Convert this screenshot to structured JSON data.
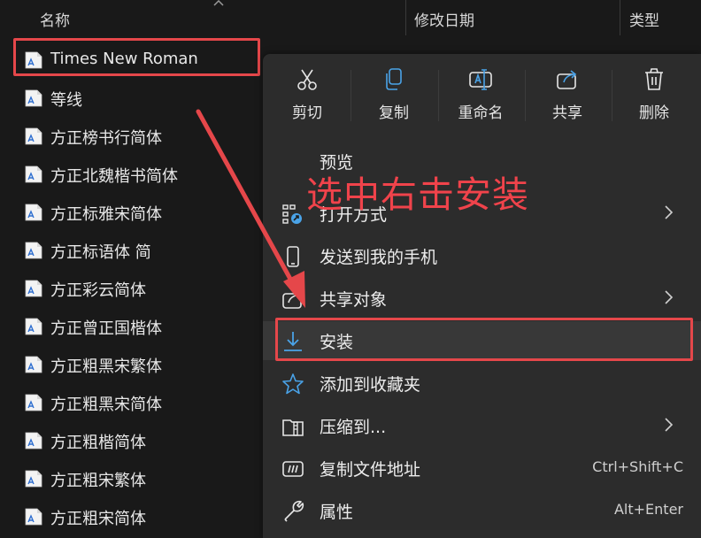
{
  "header": {
    "col_name": "名称",
    "col_date": "修改日期",
    "col_type": "类型"
  },
  "files": [
    {
      "name": "Times New Roman",
      "icon": "font-file-icon"
    },
    {
      "name": "等线",
      "icon": "font-file-icon"
    },
    {
      "name": "方正榜书行简体",
      "icon": "font-file-icon"
    },
    {
      "name": "方正北魏楷书简体",
      "icon": "font-file-icon"
    },
    {
      "name": "方正标雅宋简体",
      "icon": "font-file-icon"
    },
    {
      "name": "方正标语体 简",
      "icon": "font-file-icon"
    },
    {
      "name": "方正彩云简体",
      "icon": "font-file-icon"
    },
    {
      "name": "方正曾正国楷体",
      "icon": "font-file-icon"
    },
    {
      "name": "方正粗黑宋繁体",
      "icon": "font-file-icon"
    },
    {
      "name": "方正粗黑宋简体",
      "icon": "font-file-icon"
    },
    {
      "name": "方正粗楷简体",
      "icon": "font-file-icon"
    },
    {
      "name": "方正粗宋繁体",
      "icon": "font-file-icon"
    },
    {
      "name": "方正粗宋简体",
      "icon": "font-file-icon"
    }
  ],
  "context_menu": {
    "quick_actions": [
      {
        "label": "剪切",
        "icon": "cut-icon"
      },
      {
        "label": "复制",
        "icon": "copy-icon"
      },
      {
        "label": "重命名",
        "icon": "rename-icon"
      },
      {
        "label": "共享",
        "icon": "share-icon"
      },
      {
        "label": "删除",
        "icon": "delete-icon"
      }
    ],
    "items": [
      {
        "label": "预览",
        "icon": "",
        "submenu": false,
        "shortcut": ""
      },
      {
        "label": "打开方式",
        "icon": "open-with-icon",
        "submenu": true,
        "shortcut": ""
      },
      {
        "label": "发送到我的手机",
        "icon": "phone-icon",
        "submenu": false,
        "shortcut": ""
      },
      {
        "label": "共享对象",
        "icon": "share-with-icon",
        "submenu": true,
        "shortcut": ""
      },
      {
        "label": "安装",
        "icon": "install-icon",
        "submenu": false,
        "shortcut": ""
      },
      {
        "label": "添加到收藏夹",
        "icon": "star-icon",
        "submenu": false,
        "shortcut": ""
      },
      {
        "label": "压缩到...",
        "icon": "zip-icon",
        "submenu": true,
        "shortcut": ""
      },
      {
        "label": "复制文件地址",
        "icon": "copy-path-icon",
        "submenu": false,
        "shortcut": "Ctrl+Shift+C"
      },
      {
        "label": "属性",
        "icon": "wrench-icon",
        "submenu": false,
        "shortcut": "Alt+Enter"
      }
    ]
  },
  "annotation": {
    "text": "选中右击安装",
    "color": "#f0434b"
  },
  "colors": {
    "background": "#191919",
    "menu_background": "#2c2c2c",
    "highlight_border": "#e5474a",
    "accent_blue": "#4aa3e8"
  }
}
